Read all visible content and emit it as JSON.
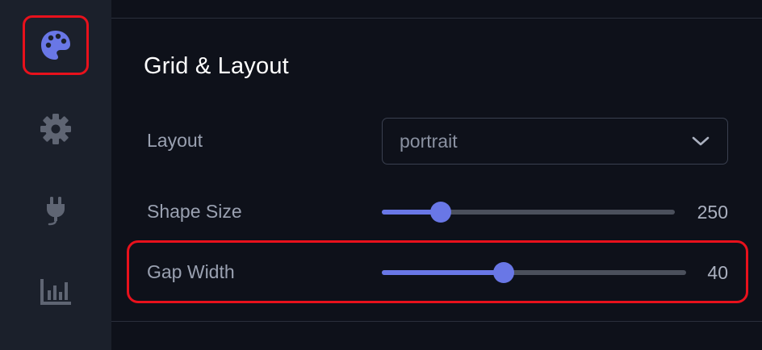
{
  "sidebar": {
    "items": [
      {
        "icon": "palette-icon",
        "active": true
      },
      {
        "icon": "gear-icon",
        "active": false
      },
      {
        "icon": "plug-icon",
        "active": false
      },
      {
        "icon": "bar-chart-icon",
        "active": false
      }
    ]
  },
  "panel": {
    "title": "Grid & Layout",
    "layout": {
      "label": "Layout",
      "value": "portrait"
    },
    "shape_size": {
      "label": "Shape Size",
      "value": "250",
      "fraction": 0.2
    },
    "gap_width": {
      "label": "Gap Width",
      "value": "40",
      "fraction": 0.4
    }
  },
  "colors": {
    "accent": "#6977e6",
    "highlight": "#e8111c",
    "sidebar_bg": "#1b202b",
    "panel_bg": "#0e111a"
  }
}
